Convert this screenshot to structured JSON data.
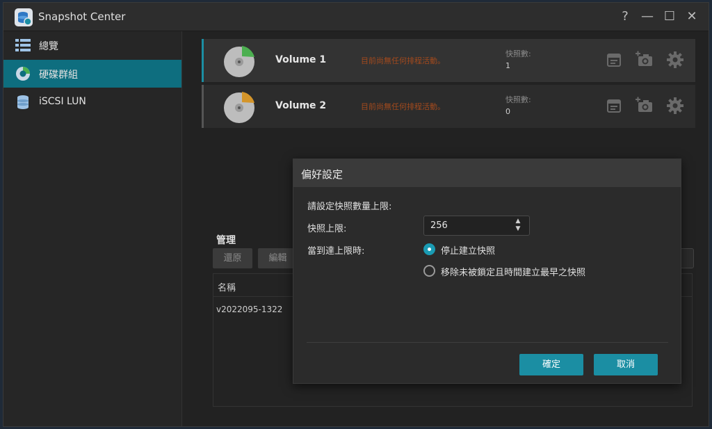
{
  "app": {
    "title": "Snapshot Center"
  },
  "window_controls": {
    "help": "?",
    "minimize": "—",
    "maximize": "☐",
    "close": "✕"
  },
  "sidebar": {
    "items": [
      {
        "label": "總覽",
        "icon": "list-icon",
        "active": false
      },
      {
        "label": "硬碟群組",
        "icon": "donut-chart-icon",
        "active": true
      },
      {
        "label": "iSCSI LUN",
        "icon": "database-icon",
        "active": false
      }
    ]
  },
  "volumes": [
    {
      "name": "Volume 1",
      "schedule_status": "目前尚無任何排程活動。",
      "count_label": "快照數:",
      "count_value": "1",
      "accent": "#4caf50",
      "selected": true
    },
    {
      "name": "Volume 2",
      "schedule_status": "目前尚無任何排程活動。",
      "count_label": "快照數:",
      "count_value": "0",
      "accent": "#d4952a",
      "selected": false
    }
  ],
  "management": {
    "title": "管理",
    "buttons": [
      {
        "label": "還原"
      },
      {
        "label": "編輯"
      }
    ],
    "table": {
      "columns": [
        "名稱"
      ],
      "rows": [
        [
          "v2022095-1322"
        ]
      ]
    }
  },
  "dialog": {
    "title": "偏好設定",
    "prompt": "請設定快照數量上限:",
    "limit_label": "快照上限:",
    "limit_value": "256",
    "when_label": "當到達上限時:",
    "options": [
      {
        "label": "停止建立快照",
        "selected": true
      },
      {
        "label": "移除未被鎖定且時間建立最早之快照",
        "selected": false
      }
    ],
    "ok_label": "確定",
    "cancel_label": "取消"
  },
  "colors": {
    "accent": "#1b8ea3",
    "sidebar_active": "#0e6e7f",
    "warning_text": "#a34a1d"
  }
}
